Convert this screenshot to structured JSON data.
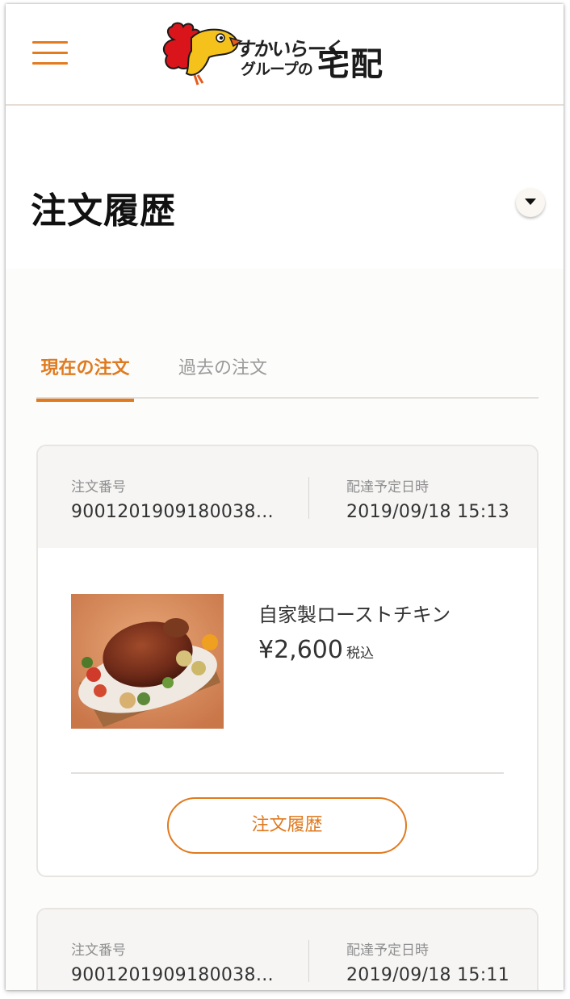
{
  "header": {
    "logo_line1": "すかいらーく",
    "logo_line2": "グループの",
    "logo_big": "宅配"
  },
  "page": {
    "title": "注文履歴"
  },
  "tabs": [
    {
      "label": "現在の注文",
      "active": true
    },
    {
      "label": "過去の注文",
      "active": false
    }
  ],
  "orders": [
    {
      "number_label": "注文番号",
      "number_value": "9001201909180038…",
      "date_label": "配達予定日時",
      "date_value": "2019/09/18 15:13",
      "item_name": "自家製ローストチキン",
      "price": "¥2,600",
      "tax": "税込",
      "button_label": "注文履歴"
    },
    {
      "number_label": "注文番号",
      "number_value": "9001201909180038…",
      "date_label": "配達予定日時",
      "date_value": "2019/09/18 15:11"
    }
  ],
  "colors": {
    "accent": "#e07a1f",
    "header_bg": "#f6f5f4"
  },
  "icons": {
    "menu": "hamburger-menu-icon",
    "dropdown": "caret-down-icon",
    "mascot": "rooster-mascot-logo"
  }
}
